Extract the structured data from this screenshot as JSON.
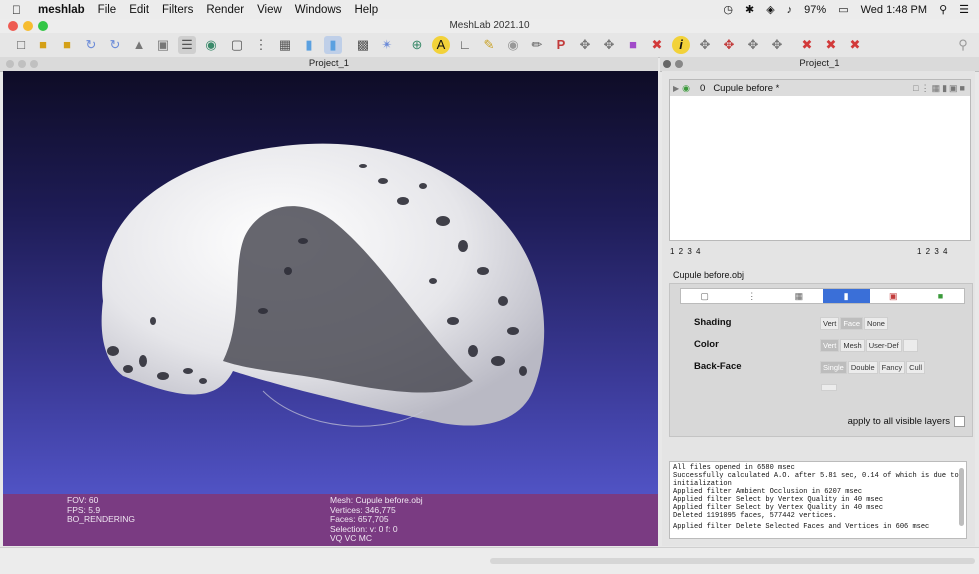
{
  "menubar": {
    "items": [
      "meshlab",
      "File",
      "Edit",
      "Filters",
      "Render",
      "View",
      "Windows",
      "Help"
    ],
    "battery": "97%",
    "clock": "Wed 1:48 PM"
  },
  "window": {
    "title": "MeshLab 2021.10"
  },
  "viewer": {
    "title": "Project_1",
    "info_left": [
      "FOV: 60",
      "FPS:     5.9",
      "BO_RENDERING"
    ],
    "info_right": [
      "Mesh: Cupule before.obj",
      "Vertices: 346,775",
      "Faces: 657,705",
      "Selection: v: 0 f: 0",
      "VQ VC MC"
    ]
  },
  "panel": {
    "title": "Project_1",
    "layer": {
      "index": "0",
      "name": "Cupule before *"
    },
    "nums_left": "1 2 3 4",
    "nums_right": "1 2 3 4",
    "object_label": "Cupule before.obj",
    "shading": {
      "label": "Shading",
      "options": [
        "Vert",
        "Face",
        "None"
      ]
    },
    "color": {
      "label": "Color",
      "options": [
        "Vert",
        "Mesh",
        "User-Def"
      ]
    },
    "backface": {
      "label": "Back-Face",
      "options": [
        "Single",
        "Double",
        "Fancy",
        "Cull"
      ]
    },
    "apply_label": "apply to all visible layers"
  },
  "log": [
    "All files opened in 6580 msec",
    "Successfully calculated A.O. after 5.81 sec, 0.14 of which is due to",
    "initialization",
    "Applied filter Ambient Occlusion in 6207 msec",
    "Applied filter Select by Vertex Quality in 40 msec",
    "Applied filter Select by Vertex Quality in 40 msec",
    "Deleted 1191095 faces, 577442 vertices.",
    "Applied filter Delete Selected Faces and Vertices in 606 msec"
  ],
  "colors": {
    "info_bar": "#7a3b82",
    "accent": "#3a6fd8"
  }
}
